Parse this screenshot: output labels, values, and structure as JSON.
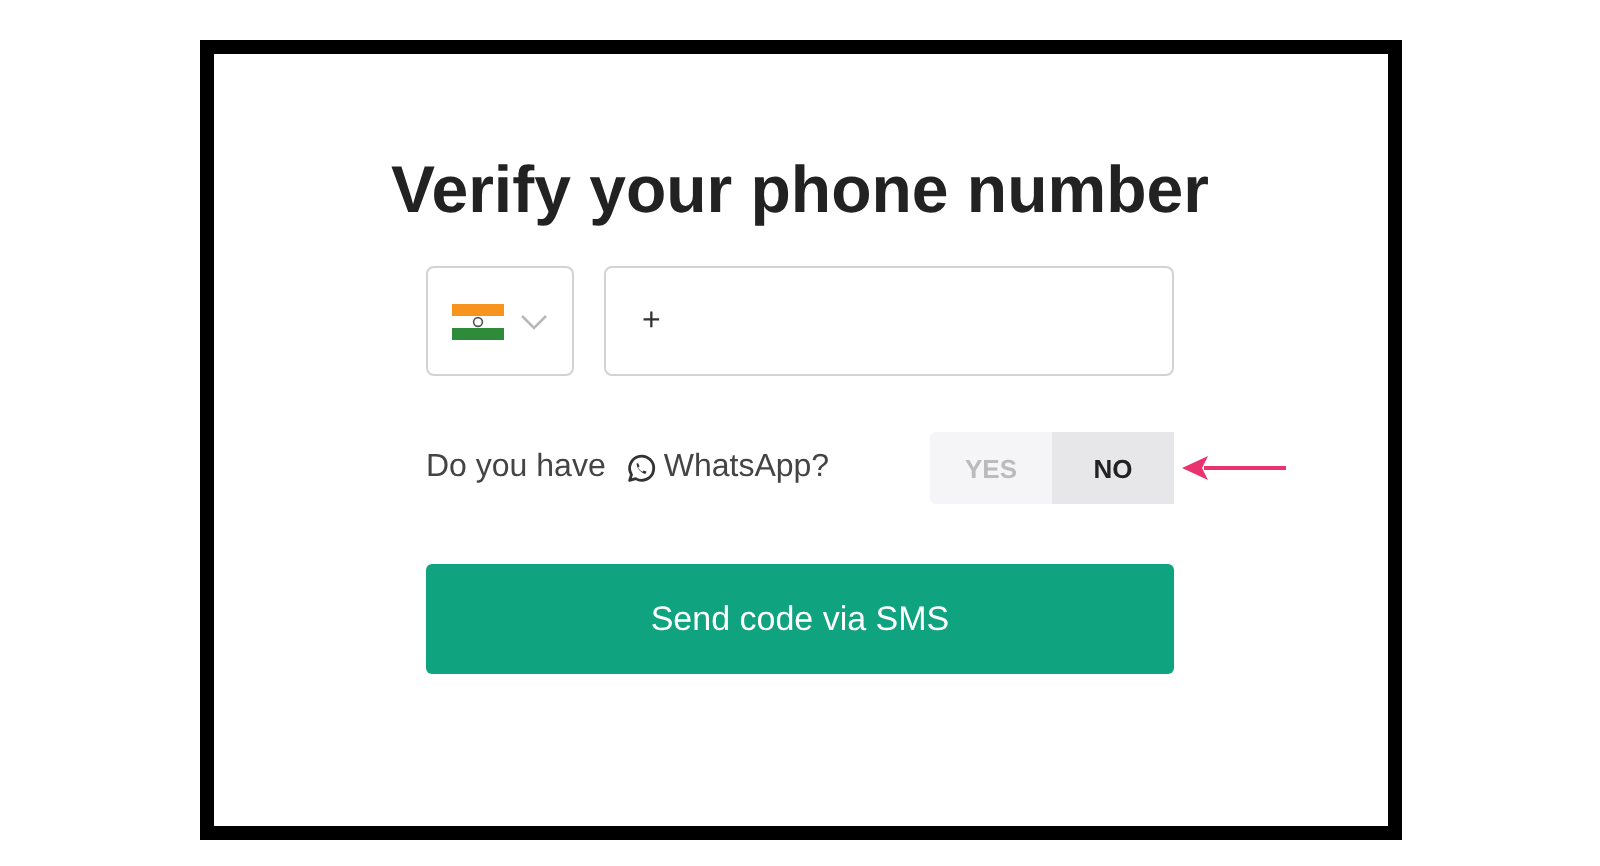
{
  "title": "Verify your phone number",
  "phone": {
    "value": "+"
  },
  "whatsapp": {
    "label_before": "Do you have",
    "label_after": "WhatsApp?",
    "options": [
      {
        "label": "YES",
        "selected": false
      },
      {
        "label": "NO",
        "selected": true
      }
    ]
  },
  "button": "Send code via SMS"
}
